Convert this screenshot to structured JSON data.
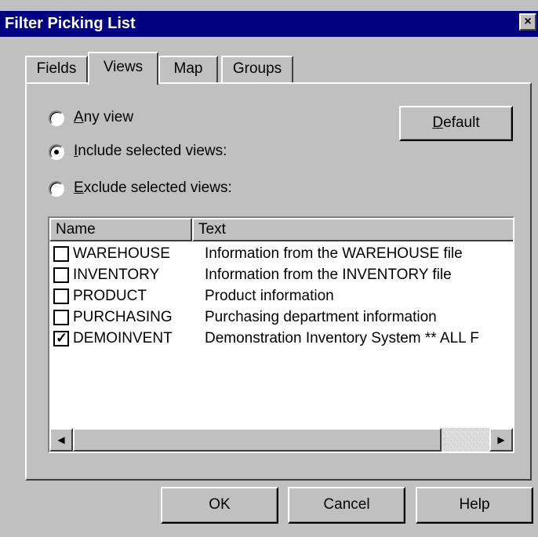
{
  "window": {
    "title": "Filter Picking List",
    "close_glyph": "×"
  },
  "tabs": [
    {
      "label": "Fields",
      "active": false
    },
    {
      "label": "Views",
      "active": true
    },
    {
      "label": "Map",
      "active": false
    },
    {
      "label": "Groups",
      "active": false
    }
  ],
  "options": {
    "any_view": {
      "mnemonic": "A",
      "rest": "ny view",
      "selected": false
    },
    "include": {
      "mnemonic": "I",
      "rest": "nclude selected views:",
      "selected": true
    },
    "exclude": {
      "mnemonic": "E",
      "rest": "xclude selected views:",
      "selected": false
    }
  },
  "default_button": {
    "mnemonic": "D",
    "rest": "efault"
  },
  "list": {
    "columns": [
      "Name",
      "Text"
    ],
    "rows": [
      {
        "name": "WAREHOUSE",
        "text": "Information from the WAREHOUSE file",
        "checked": false
      },
      {
        "name": "INVENTORY",
        "text": "Information from the INVENTORY file",
        "checked": false
      },
      {
        "name": "PRODUCT",
        "text": "Product information",
        "checked": false
      },
      {
        "name": "PURCHASING",
        "text": "Purchasing department information",
        "checked": false
      },
      {
        "name": "DEMOINVENT",
        "text": "Demonstration Inventory System  ** ALL F",
        "checked": true
      }
    ]
  },
  "scrollbar": {
    "left_arrow": "◀",
    "right_arrow": "▶",
    "position": 0
  },
  "footer": {
    "ok_label": "OK",
    "cancel_label": "Cancel",
    "help_label": "Help"
  }
}
